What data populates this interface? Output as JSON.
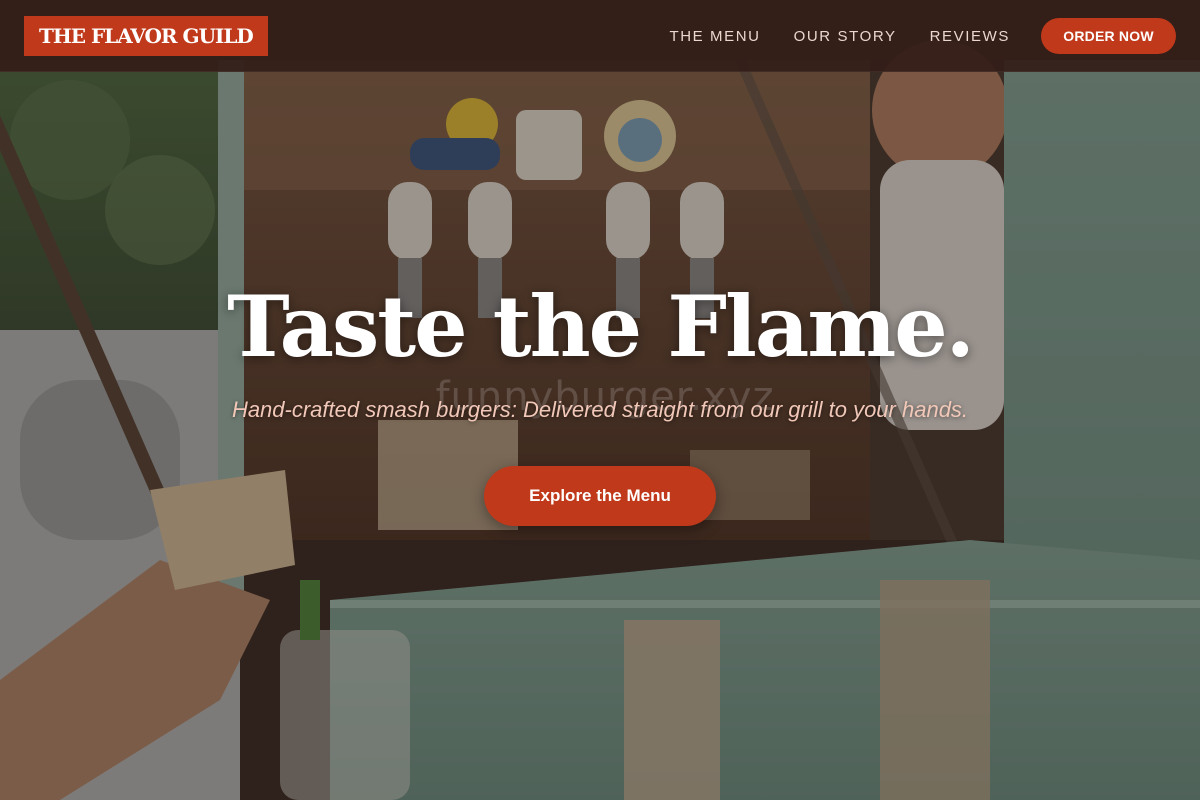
{
  "header": {
    "logo_text": "THE FLAVOR GUILD",
    "nav": [
      {
        "label": "THE MENU"
      },
      {
        "label": "OUR STORY"
      },
      {
        "label": "REVIEWS"
      }
    ],
    "order_button": "ORDER NOW"
  },
  "hero": {
    "headline": "Taste the Flame.",
    "subheadline": "Hand-crafted smash burgers: Delivered straight from our grill to your hands.",
    "cta_label": "Explore the Menu",
    "image_watermark": "funnyburger.xyz"
  },
  "colors": {
    "accent": "#c0391b",
    "navbar_bg": "#341e18",
    "headline": "#ffffff",
    "subheadline": "#f1c7b8"
  }
}
